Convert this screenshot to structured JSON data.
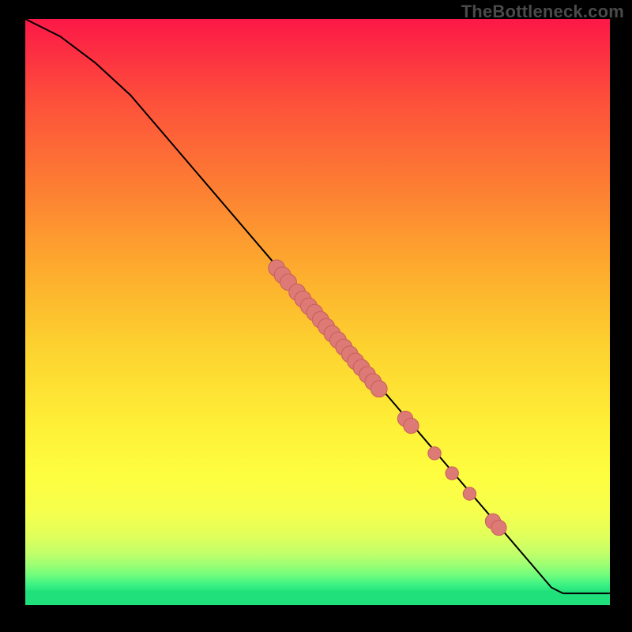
{
  "watermark": "TheBottleneck.com",
  "colors": {
    "bg": "#000000",
    "curve": "#000000",
    "marker_fill": "#de7a75",
    "marker_stroke": "#c8615f",
    "green_band": "#1fe07a",
    "watermark_text": "#4a4a4a"
  },
  "chart_data": {
    "type": "line",
    "title": "",
    "xlabel": "",
    "ylabel": "",
    "xlim": [
      0,
      100
    ],
    "ylim": [
      0,
      100
    ],
    "gradient_stops": [
      {
        "offset": 0,
        "color": "#fc1847"
      },
      {
        "offset": 14,
        "color": "#fd503b"
      },
      {
        "offset": 28,
        "color": "#fd7c33"
      },
      {
        "offset": 42,
        "color": "#fda92e"
      },
      {
        "offset": 56,
        "color": "#fdd22f"
      },
      {
        "offset": 70,
        "color": "#fef137"
      },
      {
        "offset": 78,
        "color": "#fefe40"
      },
      {
        "offset": 84,
        "color": "#f6ff4c"
      },
      {
        "offset": 88,
        "color": "#e2ff5a"
      },
      {
        "offset": 91,
        "color": "#c4ff68"
      },
      {
        "offset": 93,
        "color": "#9fff73"
      },
      {
        "offset": 95,
        "color": "#6dfc7d"
      },
      {
        "offset": 96.5,
        "color": "#3bf284"
      },
      {
        "offset": 98,
        "color": "#1fe07a"
      },
      {
        "offset": 100,
        "color": "#1fe07a"
      }
    ],
    "curve": [
      {
        "x": 0,
        "y": 100
      },
      {
        "x": 6,
        "y": 97
      },
      {
        "x": 12,
        "y": 92.5
      },
      {
        "x": 18,
        "y": 87
      },
      {
        "x": 90,
        "y": 3
      },
      {
        "x": 92,
        "y": 2
      },
      {
        "x": 100,
        "y": 2
      }
    ],
    "markers": [
      {
        "x": 43.0,
        "y": 57.5,
        "r": 1.4
      },
      {
        "x": 44.0,
        "y": 56.3,
        "r": 1.4
      },
      {
        "x": 45.0,
        "y": 55.1,
        "r": 1.4
      },
      {
        "x": 46.5,
        "y": 53.4,
        "r": 1.4
      },
      {
        "x": 47.5,
        "y": 52.2,
        "r": 1.4
      },
      {
        "x": 48.5,
        "y": 51.0,
        "r": 1.4
      },
      {
        "x": 49.5,
        "y": 49.9,
        "r": 1.4
      },
      {
        "x": 50.5,
        "y": 48.7,
        "r": 1.4
      },
      {
        "x": 51.5,
        "y": 47.5,
        "r": 1.4
      },
      {
        "x": 52.5,
        "y": 46.3,
        "r": 1.4
      },
      {
        "x": 53.5,
        "y": 45.2,
        "r": 1.4
      },
      {
        "x": 54.5,
        "y": 44.0,
        "r": 1.4
      },
      {
        "x": 55.5,
        "y": 42.8,
        "r": 1.4
      },
      {
        "x": 56.5,
        "y": 41.6,
        "r": 1.4
      },
      {
        "x": 57.5,
        "y": 40.5,
        "r": 1.4
      },
      {
        "x": 58.5,
        "y": 39.3,
        "r": 1.4
      },
      {
        "x": 59.5,
        "y": 38.1,
        "r": 1.4
      },
      {
        "x": 60.5,
        "y": 36.9,
        "r": 1.4
      },
      {
        "x": 65.0,
        "y": 31.8,
        "r": 1.3
      },
      {
        "x": 66.0,
        "y": 30.6,
        "r": 1.3
      },
      {
        "x": 70.0,
        "y": 25.9,
        "r": 1.1
      },
      {
        "x": 73.0,
        "y": 22.5,
        "r": 1.1
      },
      {
        "x": 76.0,
        "y": 19.0,
        "r": 1.1
      },
      {
        "x": 80.0,
        "y": 14.3,
        "r": 1.3
      },
      {
        "x": 81.0,
        "y": 13.2,
        "r": 1.3
      }
    ]
  }
}
